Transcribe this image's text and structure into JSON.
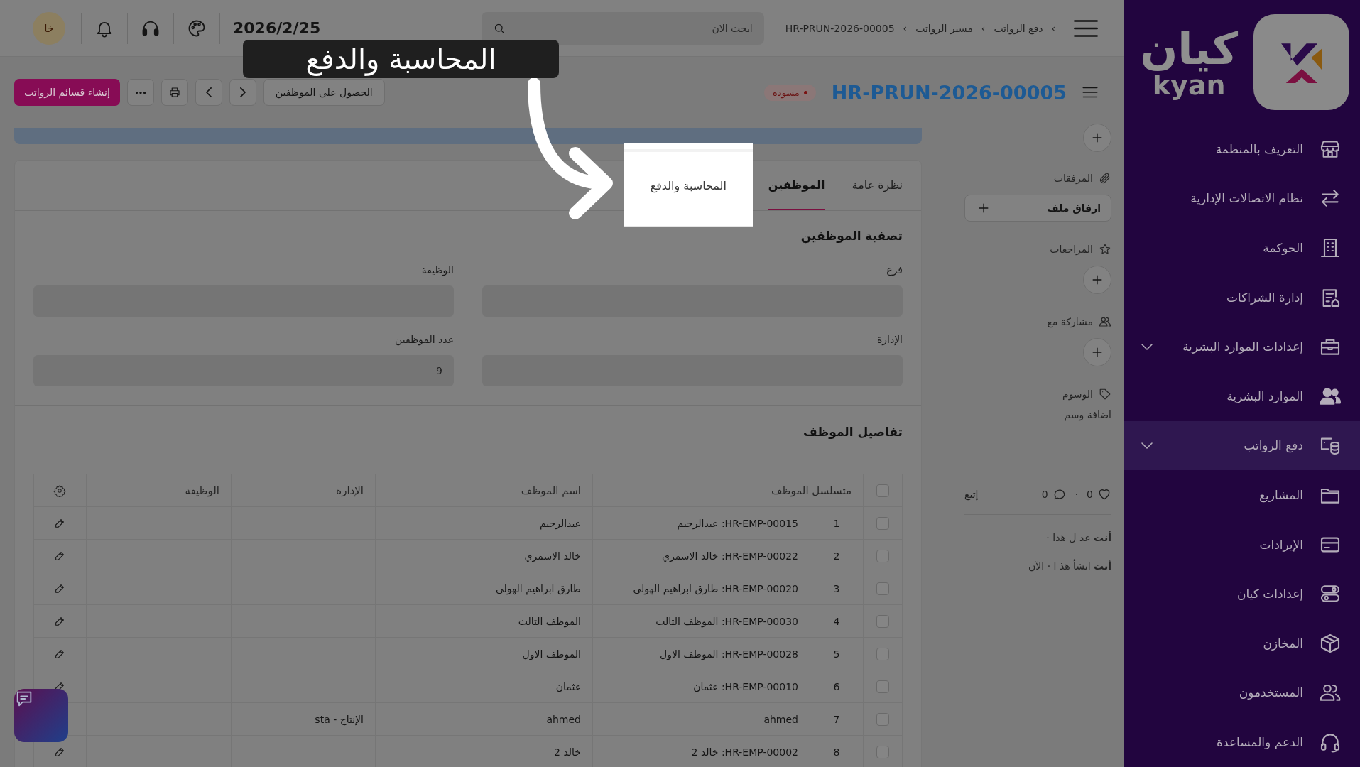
{
  "sidebar": {
    "logo_text": "كيان",
    "logo_subtext": "kyan",
    "items": [
      {
        "label": "التعريف بالمنظمة",
        "selected": false,
        "has_submenu": false
      },
      {
        "label": "نظام الاتصالات الإدارية",
        "selected": false,
        "has_submenu": false
      },
      {
        "label": "الحوكمة",
        "selected": false,
        "has_submenu": false
      },
      {
        "label": "إدارة الشراكات",
        "selected": false,
        "has_submenu": false
      },
      {
        "label": "إعدادات الموارد البشرية",
        "selected": false,
        "has_submenu": true
      },
      {
        "label": "الموارد البشرية",
        "selected": false,
        "has_submenu": false
      },
      {
        "label": "دفع الرواتب",
        "selected": true,
        "has_submenu": true
      },
      {
        "label": "المشاريع",
        "selected": false,
        "has_submenu": false
      },
      {
        "label": "الإيرادات",
        "selected": false,
        "has_submenu": false
      },
      {
        "label": "إعدادات كيان",
        "selected": false,
        "has_submenu": false
      },
      {
        "label": "المخازن",
        "selected": false,
        "has_submenu": false
      },
      {
        "label": "المستخدمون",
        "selected": false,
        "has_submenu": false
      },
      {
        "label": "الدعم والمساعدة",
        "selected": false,
        "has_submenu": false
      }
    ]
  },
  "header": {
    "breadcrumb_separator": "›",
    "breadcrumbs": [
      "دفع الرواتب",
      "مسير الرواتب",
      "HR-PRUN-2026-00005"
    ],
    "search": {
      "placeholder": "ابحث الان"
    },
    "date": "2026/2/25",
    "avatar_initials": "خا"
  },
  "toolbar": {
    "title": "HR-PRUN-2026-00005",
    "status": "مسوده",
    "get_employees": "الحصول على الموظفين",
    "create_slips": "إنشاء قسائم الرواتب"
  },
  "tabs": [
    {
      "label": "نظرة عامة",
      "selected": false,
      "highlighted": false
    },
    {
      "label": "الموظفين",
      "selected": true,
      "highlighted": false
    },
    {
      "label": "المحاسبة والدفع",
      "selected": false,
      "highlighted": true
    }
  ],
  "filter_section": {
    "title": "تصفية الموظفين",
    "fields": [
      {
        "label": "فرع"
      },
      {
        "label": "الوظيفة"
      },
      {
        "label": "الإدارة"
      },
      {
        "label": "عدد الموظفين",
        "value": "9"
      }
    ]
  },
  "details_section": {
    "title": "تفاصيل الموظف",
    "table": {
      "select_all_checked": false,
      "columns": [
        "متسلسل الموظف",
        "اسم الموظف",
        "الإدارة",
        "الوظيفة"
      ],
      "rows": [
        {
          "index": "1",
          "employee": "HR-EMP-00015: عبدالرحيم",
          "name": "عبدالرحيم",
          "checked": false
        },
        {
          "index": "2",
          "employee": "HR-EMP-00022: خالد الاسمري",
          "name": "خالد الاسمري",
          "checked": false
        },
        {
          "index": "3",
          "employee": "HR-EMP-00020: طارق ابراهيم الهولي",
          "name": "طارق ابراهيم الهولي",
          "checked": false
        },
        {
          "index": "4",
          "employee": "HR-EMP-00030: الموظف الثالث",
          "name": "الموظف الثالث",
          "checked": false
        },
        {
          "index": "5",
          "employee": "HR-EMP-00028: الموظف الاول",
          "name": "الموظف الاول",
          "checked": false
        },
        {
          "index": "6",
          "employee": "HR-EMP-00010: عثمان",
          "name": "عثمان",
          "checked": false
        },
        {
          "index": "7",
          "employee": "ahmed",
          "name": "ahmed",
          "department": "الإنتاج - sta",
          "checked": false
        },
        {
          "index": "8",
          "employee": "HR-EMP-00002: خالد 2",
          "name": "خالد 2",
          "checked": false
        }
      ]
    }
  },
  "side_panel": {
    "attachments": {
      "title": "المرفقات",
      "button": "ارفاق ملف"
    },
    "reviews": {
      "title": "المراجعات"
    },
    "shared_with": {
      "title": "مشاركة مع"
    },
    "tags": {
      "title": "الوسوم",
      "add": "اضافة وسم"
    },
    "likes": "0",
    "separator": "·",
    "comments": "0",
    "follow": "إتبع",
    "activity": [
      "**أنت** عد ل هذا ·",
      "**أنت** انشأ هذ ا · الآن"
    ]
  },
  "tour": {
    "caption": "المحاسبة والدفع"
  }
}
